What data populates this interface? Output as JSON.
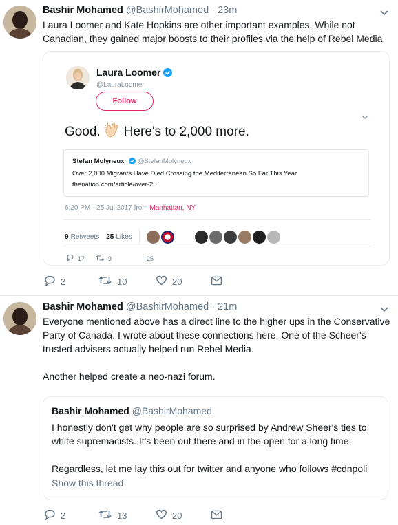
{
  "tweet1": {
    "name": "Bashir Mohamed",
    "handle": "@BashirMohamed",
    "time": "23m",
    "text": "Laura Loomer and Kate Hopkins are other important examples. While not Canadian, they gained major boosts to their profiles via the help of Rebel Media.",
    "replies": "2",
    "retweets": "10",
    "likes": "20"
  },
  "embedded": {
    "name": "Laura Loomer",
    "handle": "@LauraLoomer",
    "follow_label": "Follow",
    "text_before": "Good.",
    "text_after": "Here's to 2,000 more.",
    "quote": {
      "name": "Stefan Molyneux",
      "handle": "@StefanMolyneux",
      "text": "Over 2,000 Migrants Have Died Crossing the Mediterranean So Far This Year",
      "link": "thenation.com/article/over-2..."
    },
    "meta_time": "6:20 PM - 25 Jul 2017 from ",
    "meta_location": "Manhattan, NY",
    "retweets_count": "9",
    "retweets_label": "Retweets",
    "likes_count": "25",
    "likes_label": "Likes",
    "replies": "17",
    "retweets": "9",
    "likes": "25"
  },
  "tweet2": {
    "name": "Bashir Mohamed",
    "handle": "@BashirMohamed",
    "time": "21m",
    "paragraph1": "Everyone mentioned above has a direct line to the higher ups in the Conservative Party of Canada. I wrote about these connections here. One of the Scheer's trusted advisers actually helped run Rebel Media.",
    "paragraph2": "Another helped create a neo-nazi forum.",
    "replies": "2",
    "retweets": "13",
    "likes": "20"
  },
  "quoted": {
    "name": "Bashir Mohamed",
    "handle": "@BashirMohamed",
    "paragraph1": "I honestly don't get why people are so surprised by Andrew Sheer's ties to white supremacists. It's been out there and in the open for a long time.",
    "paragraph2": "Regardless, let me lay this out for twitter and anyone who follows #cdnpoli",
    "show_thread": "Show this thread"
  },
  "colors": {
    "accent_pink": "#e0245e",
    "verified_blue": "#1da1f2",
    "secondary_text": "#657786",
    "border": "#e6ecf0"
  },
  "icons": [
    "chevron-down-icon",
    "reply-icon",
    "retweet-icon",
    "like-icon",
    "direct-message-icon",
    "verified-icon",
    "clapping-hands-icon"
  ]
}
